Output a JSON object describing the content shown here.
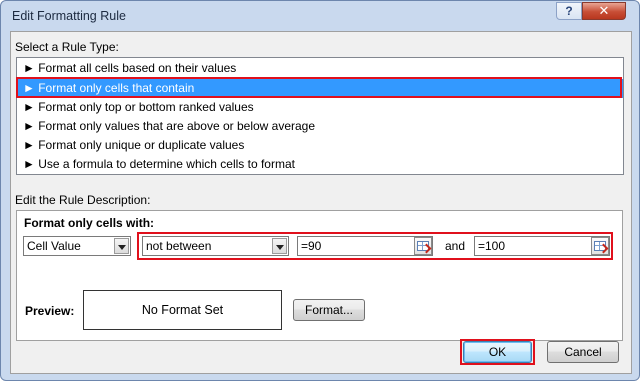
{
  "window": {
    "title": "Edit Formatting Rule",
    "help_label": "?",
    "close_label": "✕"
  },
  "rule_type": {
    "heading": "Select a Rule Type:",
    "items": [
      {
        "label": "► Format all cells based on their values"
      },
      {
        "label": "► Format only cells that contain"
      },
      {
        "label": "► Format only top or bottom ranked values"
      },
      {
        "label": "► Format only values that are above or below average"
      },
      {
        "label": "► Format only unique or duplicate values"
      },
      {
        "label": "► Use a formula to determine which cells to format"
      }
    ],
    "selected_index": 1
  },
  "description": {
    "heading": "Edit the Rule Description:",
    "format_with_label": "Format only cells with:",
    "cell_value_select": "Cell Value",
    "operator_select": "not between",
    "value1": "=90",
    "and_label": "and",
    "value2": "=100",
    "preview_label": "Preview:",
    "preview_text": "No Format Set",
    "format_button": "Format..."
  },
  "footer": {
    "ok_label": "OK",
    "cancel_label": "Cancel"
  },
  "colors": {
    "selection": "#3399ff",
    "highlight_outline": "#e0101c",
    "title_bg": "#c9d9ee"
  }
}
